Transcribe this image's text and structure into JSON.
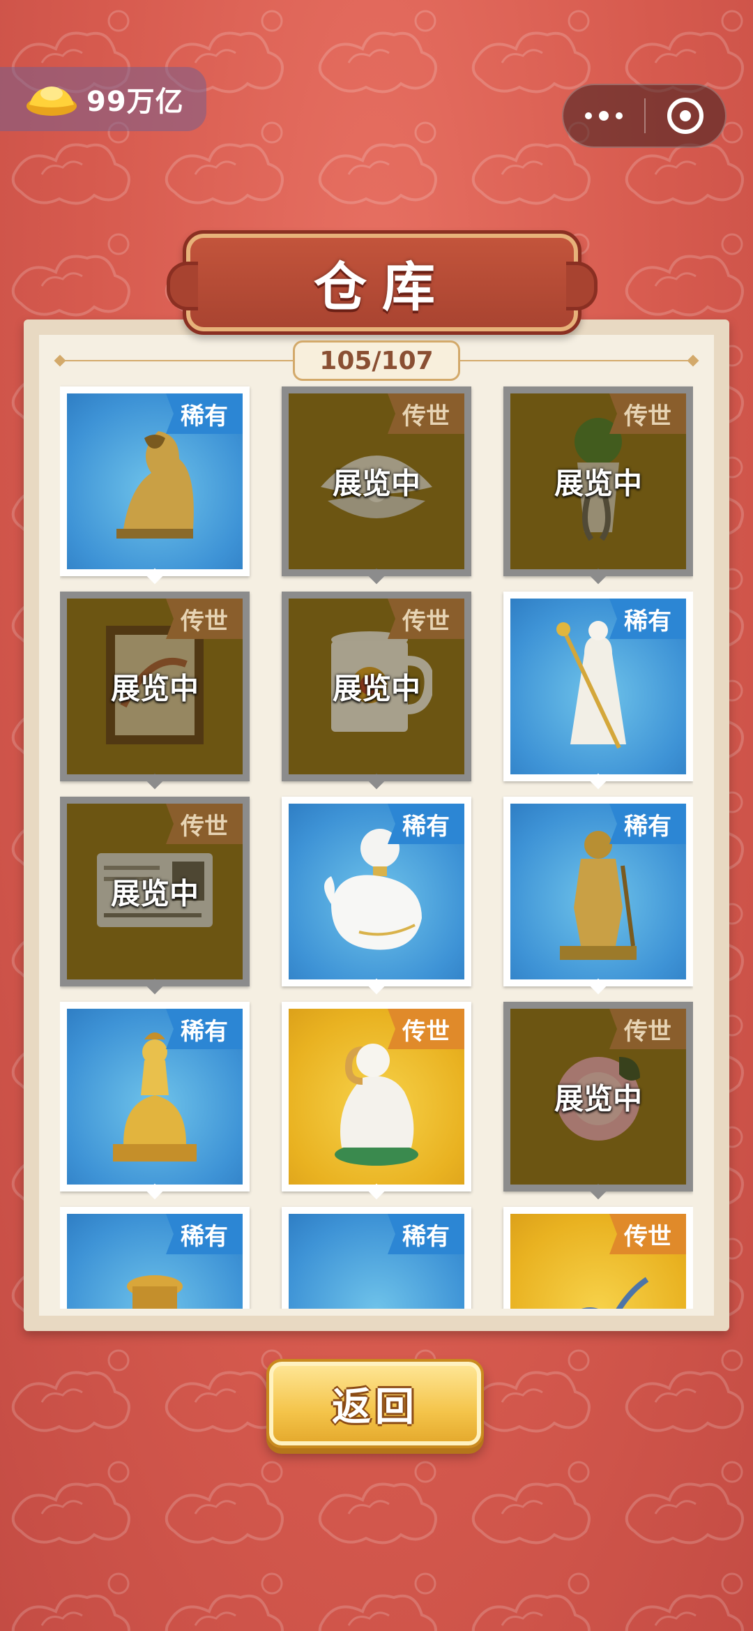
{
  "currency": {
    "value": "99万亿",
    "icon": "gold-ingot-icon"
  },
  "capsule": {
    "more_icon": "more-dots-icon",
    "close_icon": "close-target-icon"
  },
  "title": "仓库",
  "counter": "105/107",
  "tags": {
    "rare": "稀有",
    "heirloom": "传世"
  },
  "exhibit_label": "展览中",
  "items": [
    {
      "tag": "稀有",
      "status": "",
      "item": "bronze-tiger-statue"
    },
    {
      "tag": "传世",
      "status": "展览中",
      "item": "pearl-clam-shell"
    },
    {
      "tag": "传世",
      "status": "展览中",
      "item": "stone-hand-plant-pot"
    },
    {
      "tag": "传世",
      "status": "展览中",
      "item": "framed-painting"
    },
    {
      "tag": "传世",
      "status": "展览中",
      "item": "enamel-mug"
    },
    {
      "tag": "稀有",
      "status": "",
      "item": "white-porcelain-figure-with-staff"
    },
    {
      "tag": "传世",
      "status": "展览中",
      "item": "id-card"
    },
    {
      "tag": "稀有",
      "status": "",
      "item": "pearl-whale-bottle"
    },
    {
      "tag": "稀有",
      "status": "",
      "item": "golden-warrior-statue"
    },
    {
      "tag": "稀有",
      "status": "",
      "item": "golden-guanyin-statue"
    },
    {
      "tag": "传世",
      "status": "",
      "item": "porcelain-ram"
    },
    {
      "tag": "传世",
      "status": "展览中",
      "item": "pink-peony-carving"
    },
    {
      "tag": "稀有",
      "status": "",
      "item": "golden-urn"
    },
    {
      "tag": "稀有",
      "status": "",
      "item": "blue-item"
    },
    {
      "tag": "传世",
      "status": "",
      "item": "dragon-item"
    }
  ],
  "return_button": "返回"
}
